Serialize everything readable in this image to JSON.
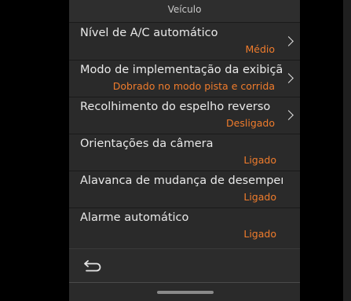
{
  "header": {
    "title": "Veículo"
  },
  "settings": [
    {
      "label": "Nível de A/C automático",
      "value": "Médio"
    },
    {
      "label": "Modo de implementação da exibição",
      "value": "Dobrado no modo pista e corrida"
    },
    {
      "label": "Recolhimento do espelho reverso",
      "value": "Desligado"
    },
    {
      "label": "Orientações da câmera",
      "value": "Ligado"
    },
    {
      "label": "Alavanca de mudança de desempenho",
      "value": "Ligado"
    },
    {
      "label": "Alarme automático",
      "value": "Ligado"
    }
  ],
  "icons": {
    "chevron": "chevron-right-icon",
    "back": "back-arrow-icon"
  },
  "colors": {
    "background": "#000000",
    "panel": "#2a2a2a",
    "text": "#e9e9e9",
    "accent": "#f07c2c"
  }
}
